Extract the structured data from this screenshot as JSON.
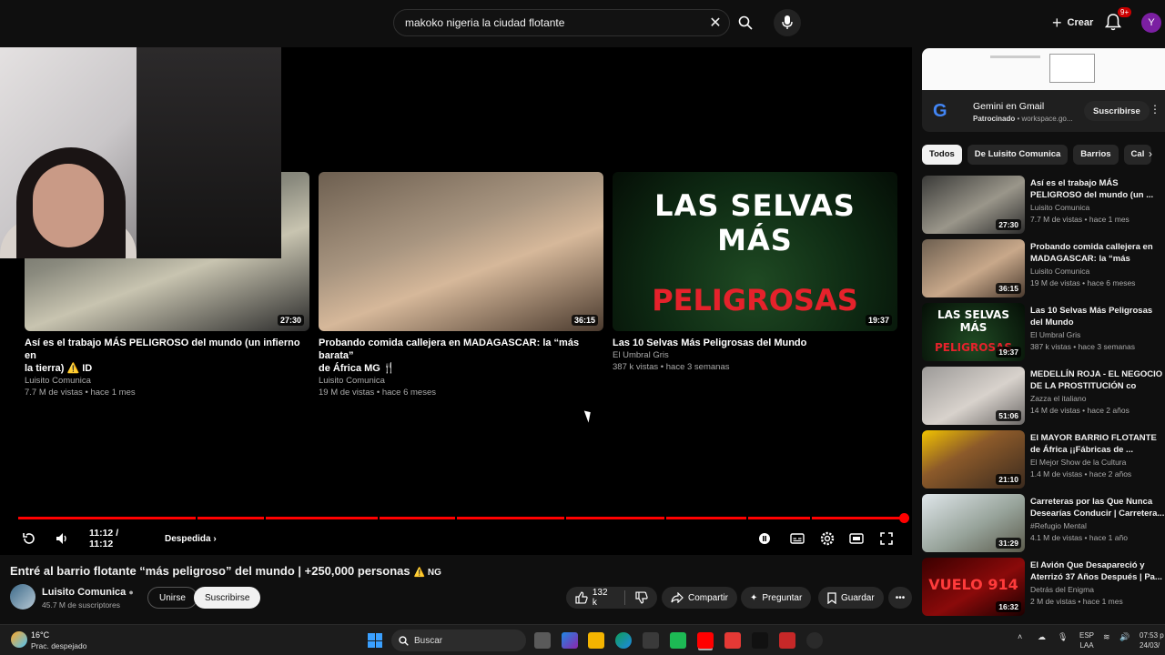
{
  "search": {
    "query": "makoko nigeria la ciudad flotante"
  },
  "header": {
    "create_label": "Crear",
    "notifications_badge": "9+",
    "avatar_letter": "Y"
  },
  "player": {
    "end_cards": [
      {
        "title_line1": "Así es el trabajo MÁS PELIGROSO del mundo (un infierno en",
        "title_line2": "la tierra) ⚠️ ID",
        "channel": "Luisito Comunica",
        "meta": "7.7 M de vistas • hace 1 mes",
        "duration": "27:30"
      },
      {
        "title_line1": "Probando comida callejera en MADAGASCAR: la “más barata”",
        "title_line2": "de África MG 🍴",
        "channel": "Luisito Comunica",
        "meta": "19 M de vistas • hace 6 meses",
        "duration": "36:15"
      },
      {
        "title_line1": "Las 10 Selvas Más Peligrosas del Mundo",
        "title_line2": "",
        "channel": "El Umbral Gris",
        "meta": "387 k vistas • hace 3 semanas",
        "duration": "19:37",
        "overlay_top": "LAS SELVAS MÁS",
        "overlay_bottom": "PELIGROSAS"
      }
    ],
    "progress_percent": 100,
    "time": "11:12 / 11:12",
    "chapter": "Despedida",
    "accent_color": "#ff0000"
  },
  "video": {
    "title": "Entré al barrio flotante “más peligroso” del mundo | +250,000 personas",
    "badge": "⚠️ NG",
    "channel": "Luisito Comunica",
    "subscribers": "45.7 M de suscriptores",
    "join_label": "Unirse",
    "subscribe_label": "Suscribirse",
    "likes": "132 k",
    "share_label": "Compartir",
    "ask_label": "Preguntar",
    "save_label": "Guardar"
  },
  "sidebar": {
    "ad": {
      "title": "Gemini en Gmail",
      "sponsored": "Patrocinado",
      "domain": "workspace.go...",
      "subscribe_label": "Suscribirse"
    },
    "chips": [
      "Todos",
      "De Luisito Comunica",
      "Barrios",
      "Cal"
    ],
    "related": [
      {
        "title": "Así es el trabajo MÁS PELIGROSO del mundo (un ...",
        "channel": "Luisito Comunica",
        "meta": "7.7 M de vistas • hace 1 mes",
        "duration": "27:30"
      },
      {
        "title": "Probando comida callejera en MADAGASCAR: la “más barata...",
        "channel": "Luisito Comunica",
        "meta": "19 M de vistas • hace 6 meses",
        "duration": "36:15"
      },
      {
        "title": "Las 10 Selvas Más Peligrosas del Mundo",
        "channel": "El Umbral Gris",
        "meta": "387 k vistas • hace 3 semanas",
        "duration": "19:37",
        "overlay_top": "LAS SELVAS MÁS",
        "overlay_bottom": "PELIGROSAS"
      },
      {
        "title": "MEDELLÍN ROJA - EL NEGOCIO DE LA PROSTITUCIÓN co",
        "channel": "Zazza el italiano",
        "meta": "14 M de vistas • hace 2 años",
        "duration": "51:06"
      },
      {
        "title": "El MAYOR BARRIO FLOTANTE de África ¡¡Fábricas de ...",
        "channel": "El Mejor Show de la Cultura",
        "meta": "1.4 M de vistas • hace 2 años",
        "duration": "21:10"
      },
      {
        "title": "Carreteras por las Que Nunca Desearías Conducir | Carretera...",
        "channel": "#Refugio Mental",
        "meta": "4.1 M de vistas • hace 1 año",
        "duration": "31:29"
      },
      {
        "title": "El Avión Que Desapareció y Aterrizó 37 Años Después | Pa...",
        "channel": "Detrás del Enigma",
        "meta": "2 M de vistas • hace 1 mes",
        "duration": "16:32",
        "overlay": "VUELO 914"
      }
    ]
  },
  "taskbar": {
    "temp": "16°C",
    "weather": "Prac. despejado",
    "search_label": "Buscar",
    "lang_top": "ESP",
    "lang_bottom": "LAA",
    "time": "07:53 p",
    "date": "24/03/"
  }
}
